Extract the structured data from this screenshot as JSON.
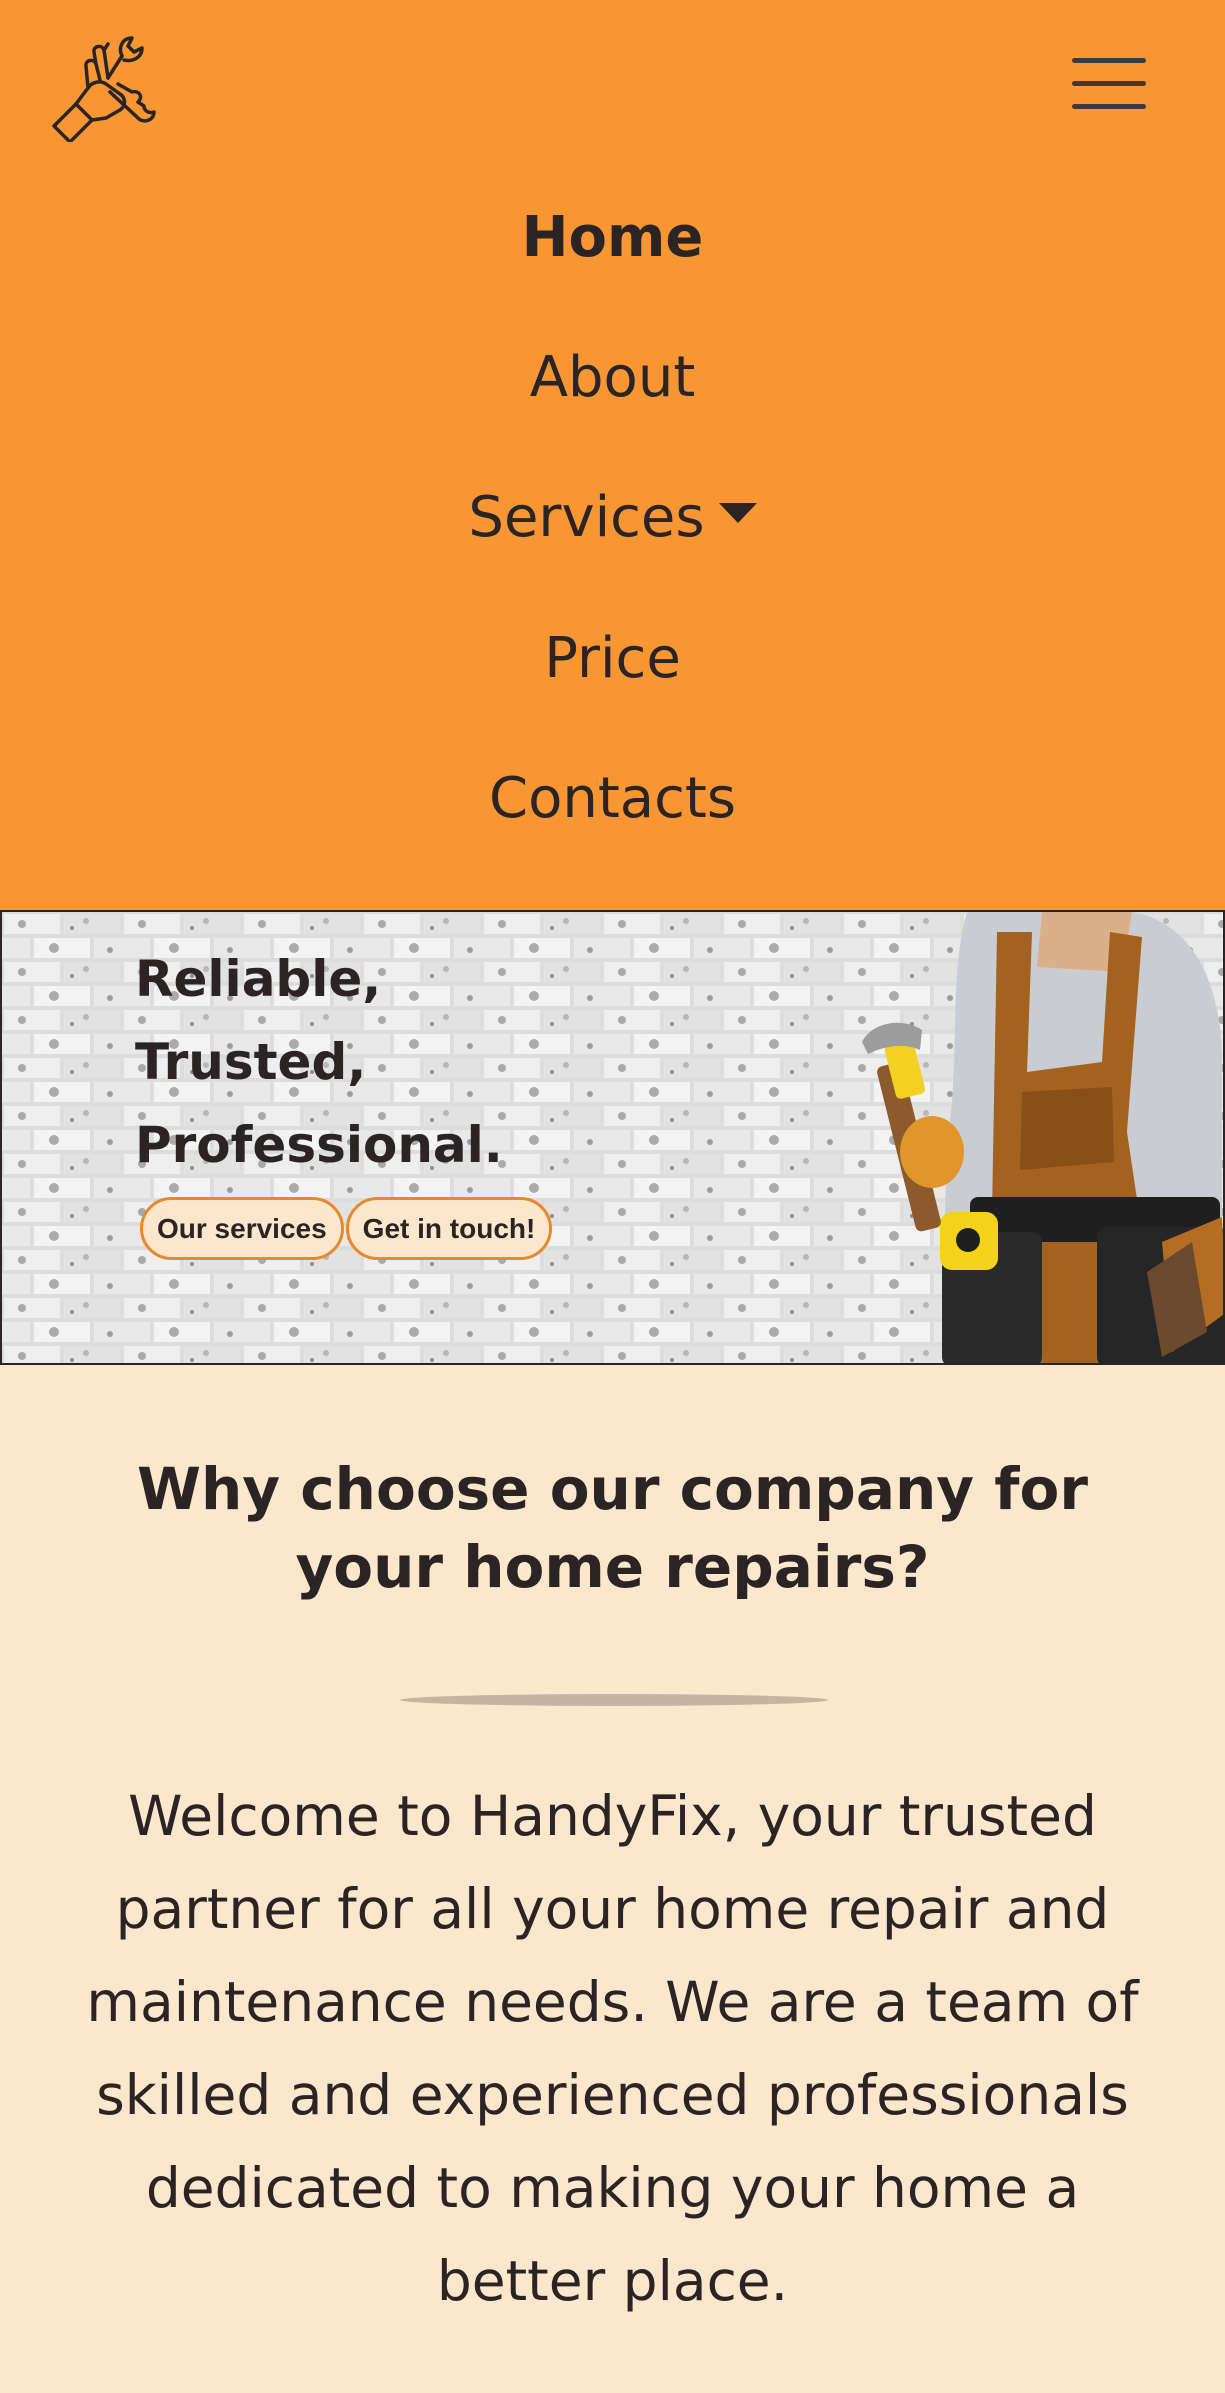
{
  "brand": {
    "logo_icon": "wrench-hand-icon"
  },
  "nav": {
    "menu_icon": "hamburger-menu-icon",
    "items": [
      {
        "label": "Home",
        "active": true
      },
      {
        "label": "About"
      },
      {
        "label": "Services",
        "has_dropdown": true
      },
      {
        "label": "Price"
      },
      {
        "label": "Contacts"
      }
    ]
  },
  "hero": {
    "lines": [
      "Reliable,",
      "Trusted,",
      "Professional."
    ],
    "buttons": [
      "Our services",
      "Get in touch!"
    ]
  },
  "about": {
    "heading": "Why choose our company for your home repairs?",
    "body": "Welcome to HandyFix, your trusted partner for all your home repair and maintenance needs. We are a team of skilled and experienced professionals dedicated to making your home a better place."
  },
  "colors": {
    "header_bg": "#f89634",
    "page_bg": "#fce6cc",
    "text": "#2a2424",
    "accent_border": "#e4892c"
  }
}
